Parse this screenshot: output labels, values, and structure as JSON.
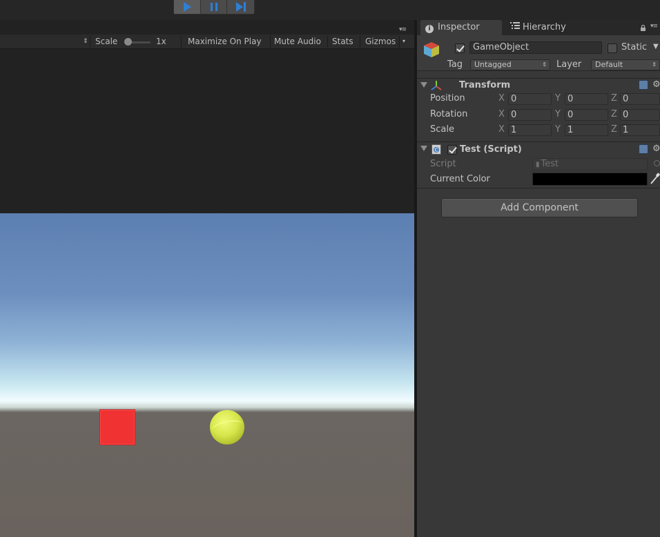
{
  "toolbar": {
    "play_icon": "play-icon",
    "pause_icon": "pause-icon",
    "step_icon": "step-icon",
    "play_active": true
  },
  "game_toolbar": {
    "scale_label": "Scale",
    "scale_value": "1x",
    "scale_slider_value": 0,
    "maximize_on_play": "Maximize On Play",
    "mute_audio": "Mute Audio",
    "stats": "Stats",
    "gizmos": "Gizmos"
  },
  "scene": {
    "cube_color": "#f03232",
    "ball_color": "#d6e64a"
  },
  "inspector": {
    "tabs": [
      {
        "label": "Inspector",
        "icon": "info-icon",
        "active": true
      },
      {
        "label": "Hierarchy",
        "icon": "list-icon",
        "active": false
      }
    ],
    "object": {
      "active": true,
      "name": "GameObject",
      "static_label": "Static",
      "static_checked": false,
      "tag_label": "Tag",
      "tag_value": "Untagged",
      "layer_label": "Layer",
      "layer_value": "Default"
    },
    "transform": {
      "title": "Transform",
      "rows": [
        {
          "label": "Position",
          "x": "0",
          "y": "0",
          "z": "0"
        },
        {
          "label": "Rotation",
          "x": "0",
          "y": "0",
          "z": "0"
        },
        {
          "label": "Scale",
          "x": "1",
          "y": "1",
          "z": "1"
        }
      ],
      "axis_x": "X",
      "axis_y": "Y",
      "axis_z": "Z"
    },
    "script_component": {
      "title": "Test (Script)",
      "enabled": true,
      "script_label": "Script",
      "script_value": "Test",
      "current_color_label": "Current Color",
      "current_color": "#000000"
    },
    "add_component": "Add Component"
  }
}
